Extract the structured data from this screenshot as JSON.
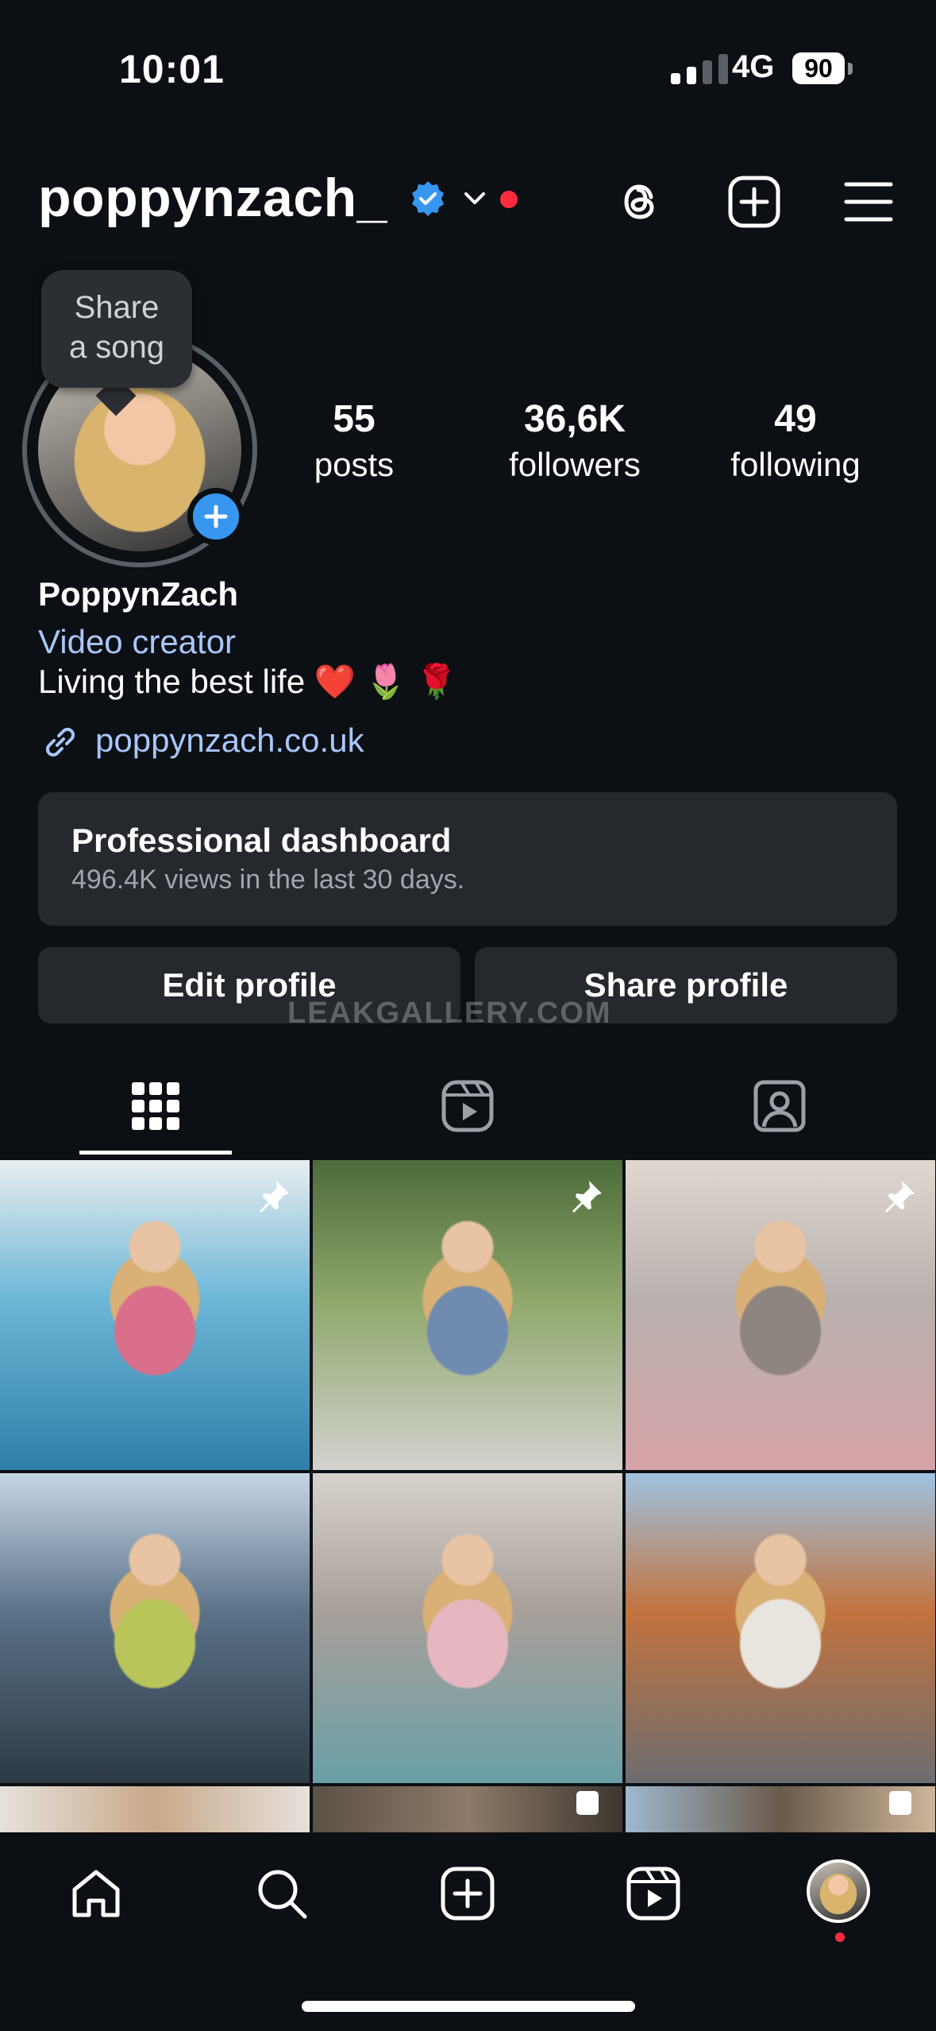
{
  "status_bar": {
    "time": "10:01",
    "network": "4G",
    "battery": "90"
  },
  "header": {
    "username": "poppynzach_"
  },
  "profile": {
    "share_song_line1": "Share",
    "share_song_line2": "a song",
    "stats": [
      {
        "value": "55",
        "label": "posts"
      },
      {
        "value": "36,6K",
        "label": "followers"
      },
      {
        "value": "49",
        "label": "following"
      }
    ],
    "full_name": "PoppynZach",
    "category": "Video creator",
    "bio": "Living the best life ❤️ 🌷 🌹",
    "link": "poppynzach.co.uk"
  },
  "dashboard": {
    "title": "Professional dashboard",
    "subtitle": "496.4K views in the last 30 days."
  },
  "buttons": {
    "edit": "Edit profile",
    "share": "Share profile"
  },
  "watermark": "LEAKGALLERY.COM",
  "tabs": [
    "grid",
    "reels",
    "tagged"
  ],
  "posts": [
    {
      "pinned": true,
      "colors": [
        "#e9eef0",
        "#6cb6d6",
        "#2f7fa8",
        "#d96f8a"
      ]
    },
    {
      "pinned": true,
      "colors": [
        "#4c6b3a",
        "#8fa76b",
        "#d3d3cf",
        "#6f8bb0"
      ]
    },
    {
      "pinned": true,
      "colors": [
        "#e0d7d0",
        "#b9b1ae",
        "#d7a3a8",
        "#8e8580"
      ]
    },
    {
      "pinned": false,
      "colors": [
        "#c7d6e5",
        "#5a7188",
        "#2d3a45",
        "#b9c45a"
      ]
    },
    {
      "pinned": false,
      "colors": [
        "#d8d2cc",
        "#a79f99",
        "#6aa0a8",
        "#e6b7c1"
      ]
    },
    {
      "pinned": false,
      "colors": [
        "#9fc2e0",
        "#c2733e",
        "#6d6d70",
        "#e8e4de"
      ]
    }
  ],
  "bottom_nav": [
    "home",
    "search",
    "create",
    "reels",
    "profile"
  ]
}
